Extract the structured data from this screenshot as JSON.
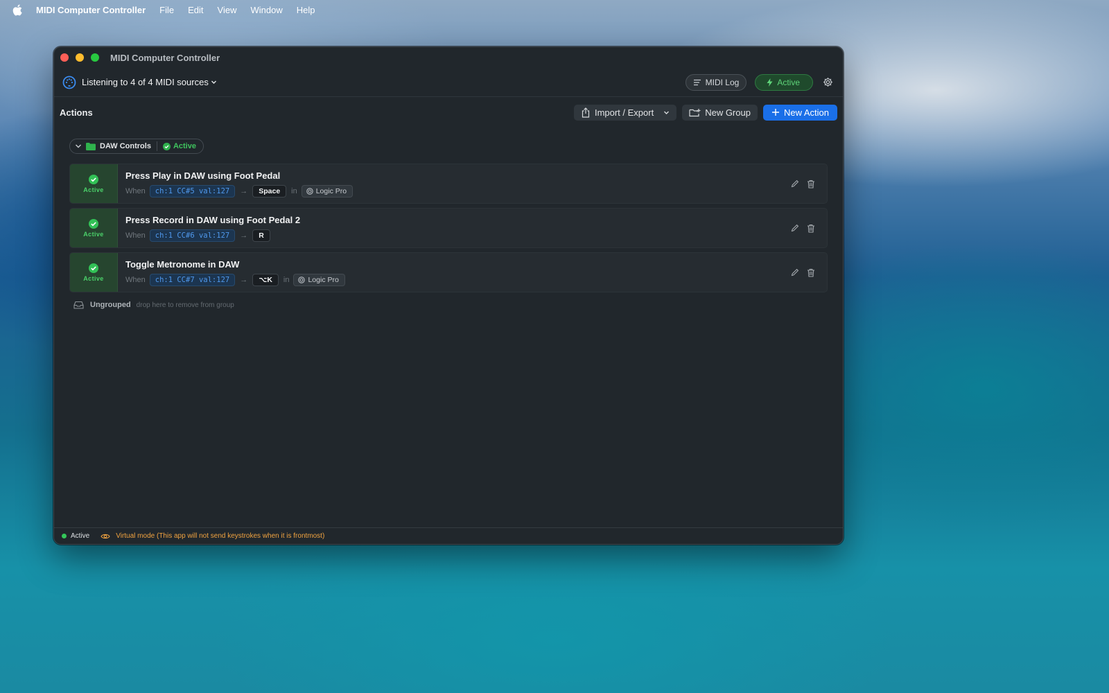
{
  "menubar": {
    "app_name": "MIDI Computer Controller",
    "items": [
      "File",
      "Edit",
      "View",
      "Window",
      "Help"
    ]
  },
  "window": {
    "title": "MIDI Computer Controller"
  },
  "toolbar": {
    "source_label": "Listening to 4 of 4 MIDI sources",
    "midi_log_label": "MIDI Log",
    "active_label": "Active"
  },
  "actions_header": {
    "title": "Actions",
    "import_export_label": "Import / Export",
    "new_group_label": "New Group",
    "new_action_label": "New Action"
  },
  "group": {
    "name": "DAW Controls",
    "status": "Active"
  },
  "actions": [
    {
      "status": "Active",
      "title": "Press Play in DAW using Foot Pedal",
      "when": "When",
      "trigger": "ch:1 CC#5 val:127",
      "arrow": "→",
      "key": "Space",
      "in": "in",
      "app": "Logic Pro"
    },
    {
      "status": "Active",
      "title": "Press Record in DAW using Foot Pedal 2",
      "when": "When",
      "trigger": "ch:1 CC#6 val:127",
      "arrow": "→",
      "key": "R"
    },
    {
      "status": "Active",
      "title": "Toggle Metronome in DAW",
      "when": "When",
      "trigger": "ch:1 CC#7 val:127",
      "arrow": "→",
      "key": "⌥K",
      "in": "in",
      "app": "Logic Pro"
    }
  ],
  "ungrouped": {
    "label": "Ungrouped",
    "hint": "drop here to remove from group"
  },
  "statusbar": {
    "status": "Active",
    "virtual_mode": "Virtual mode (This app will not send keystrokes when it is frontmost)"
  },
  "colors": {
    "accent": "#1a6fe8",
    "active_green": "#34c759",
    "warning_orange": "#f1a340",
    "window_bg": "#21272c"
  }
}
